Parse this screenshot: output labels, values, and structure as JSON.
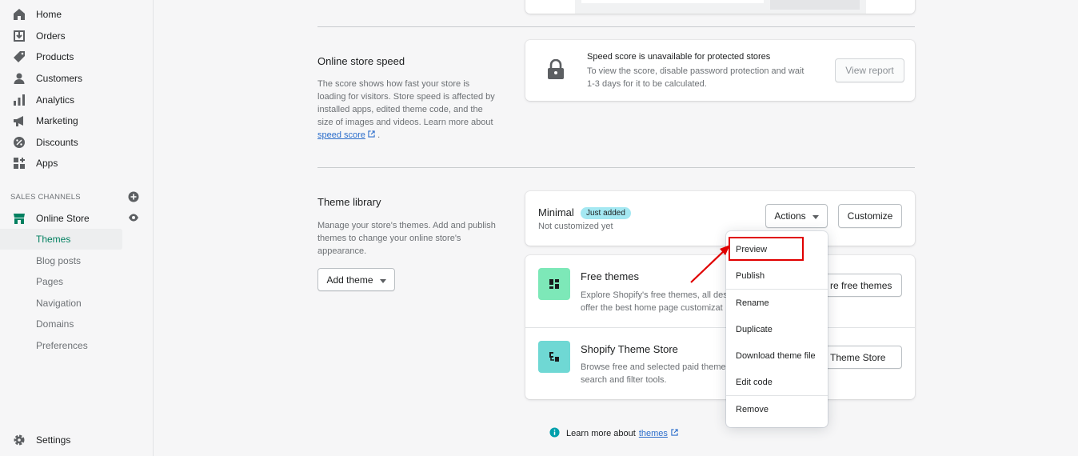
{
  "sidebar": {
    "items": [
      {
        "label": "Home",
        "icon": "home-icon"
      },
      {
        "label": "Orders",
        "icon": "orders-icon"
      },
      {
        "label": "Products",
        "icon": "tag-icon"
      },
      {
        "label": "Customers",
        "icon": "person-icon"
      },
      {
        "label": "Analytics",
        "icon": "bar-chart-icon"
      },
      {
        "label": "Marketing",
        "icon": "megaphone-icon"
      },
      {
        "label": "Discounts",
        "icon": "discount-icon"
      },
      {
        "label": "Apps",
        "icon": "apps-icon"
      }
    ],
    "section_label": "SALES CHANNELS",
    "online_store": "Online Store",
    "sub_items": [
      "Themes",
      "Blog posts",
      "Pages",
      "Navigation",
      "Domains",
      "Preferences"
    ],
    "settings": "Settings"
  },
  "speed": {
    "title": "Online store speed",
    "desc_1": "The score shows how fast your store is",
    "desc_2": "loading for visitors. Store speed is affected by",
    "desc_3": "installed apps, edited theme code, and the",
    "desc_4": "size of images and videos. Learn more about",
    "link": "speed score",
    "after_link": ".",
    "card_title": "Speed score is unavailable for protected stores",
    "card_desc_1": "To view the score, disable password protection and wait",
    "card_desc_2": "1-3 days for it to be calculated.",
    "view_report": "View report"
  },
  "library": {
    "title": "Theme library",
    "desc_1": "Manage your store's themes. Add and publish",
    "desc_2": "themes to change your online store's",
    "desc_3": "appearance.",
    "add_theme": "Add theme",
    "theme_name": "Minimal",
    "badge": "Just added",
    "status": "Not customized yet",
    "actions": "Actions",
    "customize": "Customize",
    "free_title": "Free themes",
    "free_desc_1": "Explore Shopify's free themes, all des",
    "free_desc_2": "offer the best home page customizat",
    "free_button": "re free themes",
    "store_title": "Shopify Theme Store",
    "store_desc_1": "Browse free and selected paid theme",
    "store_desc_2": "search and filter tools.",
    "store_button": "Theme Store"
  },
  "menu": {
    "items": [
      "Preview",
      "Publish",
      "Rename",
      "Duplicate",
      "Download theme file",
      "Edit code",
      "Remove"
    ]
  },
  "footer": {
    "text": "Learn more about",
    "link": "themes"
  },
  "colors": {
    "accent": "#008060",
    "highlight": "#e00000",
    "badge": "#a4e8f2",
    "theme_icon_bg": "#7de8b8"
  }
}
